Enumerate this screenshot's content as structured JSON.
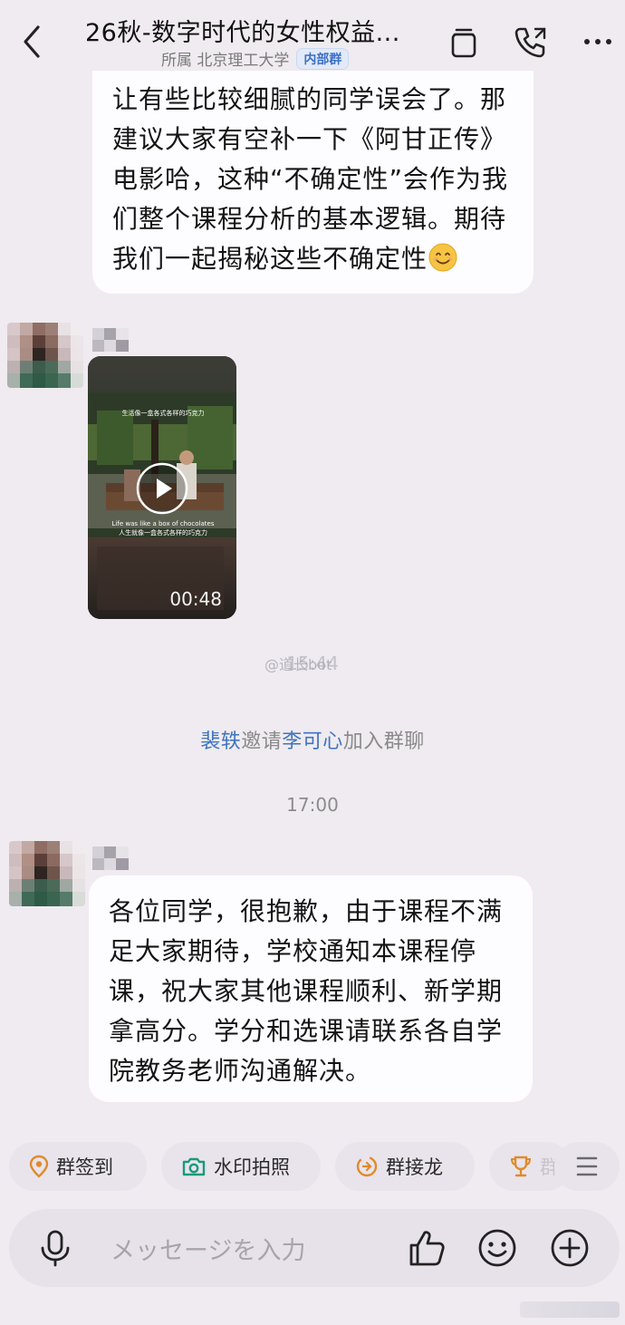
{
  "header": {
    "title": "26秋-数字时代的女性权益...",
    "org_label": "所属 北京理工大学",
    "badge": "内部群"
  },
  "messages": {
    "top_text_lines": [
      "让有些比较细腻的同学误会了。那",
      "建议大家有空补一下《阿甘正传》",
      "电影哈，这种“不确定性”会作为我",
      "们整个课程分析的基本逻辑。期待",
      "我们一起揭秘这些不确定性"
    ],
    "video": {
      "caption_top": "生活像一盒各式各样的巧克力",
      "caption_en": "Life was like a box of chocolates",
      "caption_zh": "人生就像一盒各式各样的巧克力",
      "duration": "00:48"
    },
    "time_1": "15:44",
    "watermark": "@道长bot",
    "system": {
      "inviter": "裴轶",
      "verb": "邀请",
      "invitee": "李可心",
      "suffix": "加入群聊"
    },
    "time_2": "17:00",
    "bottom_text_lines": [
      "各位同学，很抱歉，由于课程不满",
      "足大家期待，学校通知本课程停",
      "课，祝大家其他课程顺利、新学期",
      "拿高分。学分和选课请联系各自学",
      "院教务老师沟通解决。"
    ]
  },
  "quick_actions": [
    "群签到",
    "水印拍照",
    "群接龙",
    "群"
  ],
  "composer": {
    "placeholder": "メッセージを入力"
  },
  "colors": {
    "background": "#efebf0",
    "link": "#3f74bf",
    "bubble": "#fdfcfe"
  }
}
